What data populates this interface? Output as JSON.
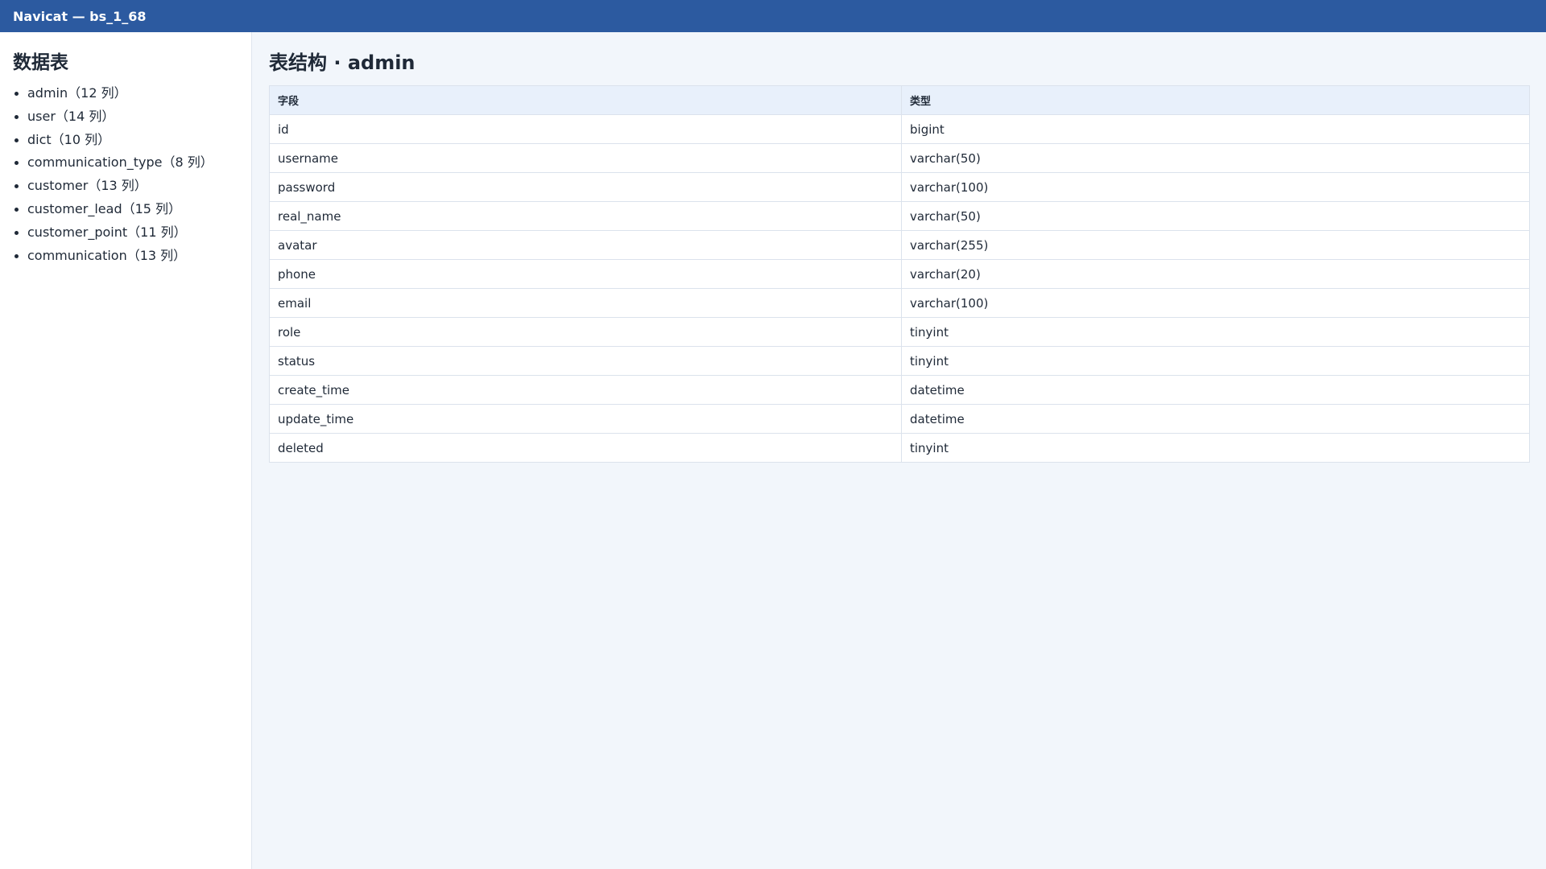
{
  "window": {
    "title": "Navicat — bs_1_68"
  },
  "sidebar": {
    "heading": "数据表",
    "tables": [
      {
        "label": "admin（12 列）"
      },
      {
        "label": "user（14 列）"
      },
      {
        "label": "dict（10 列）"
      },
      {
        "label": "communication_type（8 列）"
      },
      {
        "label": "customer（13 列）"
      },
      {
        "label": "customer_lead（15 列）"
      },
      {
        "label": "customer_point（11 列）"
      },
      {
        "label": "communication（13 列）"
      }
    ]
  },
  "main": {
    "title": "表结构 · admin",
    "columns": {
      "field": "字段",
      "type": "类型"
    },
    "rows": [
      {
        "field": "id",
        "type": "bigint"
      },
      {
        "field": "username",
        "type": "varchar(50)"
      },
      {
        "field": "password",
        "type": "varchar(100)"
      },
      {
        "field": "real_name",
        "type": "varchar(50)"
      },
      {
        "field": "avatar",
        "type": "varchar(255)"
      },
      {
        "field": "phone",
        "type": "varchar(20)"
      },
      {
        "field": "email",
        "type": "varchar(100)"
      },
      {
        "field": "role",
        "type": "tinyint"
      },
      {
        "field": "status",
        "type": "tinyint"
      },
      {
        "field": "create_time",
        "type": "datetime"
      },
      {
        "field": "update_time",
        "type": "datetime"
      },
      {
        "field": "deleted",
        "type": "tinyint"
      }
    ]
  },
  "colors": {
    "titlebar": "#2c5aa0",
    "page_bg": "#f2f6fb",
    "header_bg": "#e8f0fb"
  }
}
